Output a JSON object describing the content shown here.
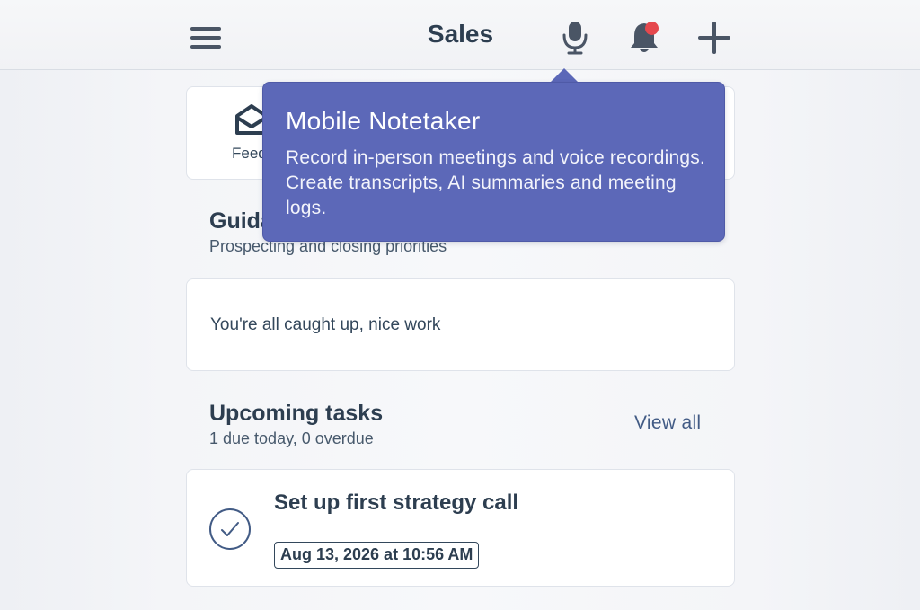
{
  "header": {
    "title": "Sales",
    "icons": [
      "menu-icon",
      "microphone-icon",
      "bell-icon",
      "plus-icon"
    ],
    "notification_dot_color": "#e5484d"
  },
  "shortcuts": {
    "feed_label": "Feed"
  },
  "tooltip": {
    "title": "Mobile Notetaker",
    "body": "Record in-person meetings and voice recordings. Create transcripts, AI summaries and meeting logs.",
    "background": "#5c68b8"
  },
  "guidance": {
    "title": "Guidance",
    "subtitle": "Prospecting and closing priorities",
    "empty_message": "You're all caught up, nice work"
  },
  "tasks": {
    "title": "Upcoming tasks",
    "subtitle": "1 due today, 0 overdue",
    "view_all": "View all",
    "items": [
      {
        "title": "Set up first strategy call",
        "due": "Aug 13, 2026 at 10:56 AM"
      }
    ]
  }
}
